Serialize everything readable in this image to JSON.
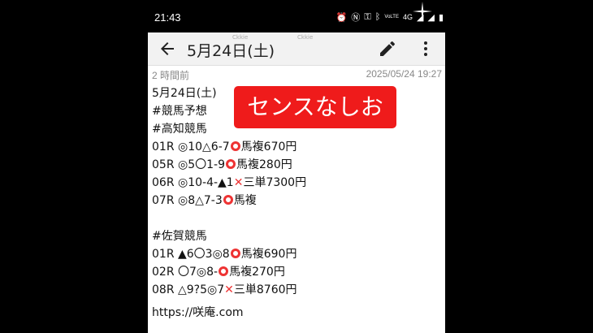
{
  "status": {
    "time": "21:43",
    "network": "4G",
    "volte": "VoLTE"
  },
  "appbar": {
    "title": "5月24日(土)",
    "watermark1": "Ckkie",
    "watermark2": "Ckkie"
  },
  "meta": {
    "relative_time": "2 時間前",
    "timestamp": "2025/05/24 19:27"
  },
  "banner": {
    "text": "センスなしお"
  },
  "post": {
    "date": "5月24日(土)",
    "tag1": "#競馬予想",
    "section1": "#高知競馬",
    "k1": {
      "race": "01R ",
      "pick": "◎10△6-7",
      "result": "馬複670円"
    },
    "k2": {
      "race": "05R ",
      "pick": "◎5〇1-9",
      "result": "馬複280円"
    },
    "k3": {
      "race": "06R ",
      "pick": "◎10-4-▲1",
      "result": "三単7300円"
    },
    "k4": {
      "race": "07R ",
      "pick": "◎8△7-3",
      "result": "馬複"
    },
    "section2": "#佐賀競馬",
    "s1": {
      "race": "01R ",
      "pick": "▲6〇3◎8",
      "result": "馬複690円"
    },
    "s2": {
      "race": "02R ",
      "pick": "〇7◎8-",
      "result": "馬複270円"
    },
    "s3": {
      "race": "08R ",
      "pick": "△9?5◎7",
      "result": "三単8760円"
    },
    "link": "https://咲庵.com"
  },
  "colors": {
    "banner": "#ef1b1b",
    "hit_mark": "#e33",
    "appbar": "#f2f2f2"
  },
  "icons": {
    "back": "arrow-left-icon",
    "edit": "pencil-icon",
    "more": "more-vert-icon"
  }
}
